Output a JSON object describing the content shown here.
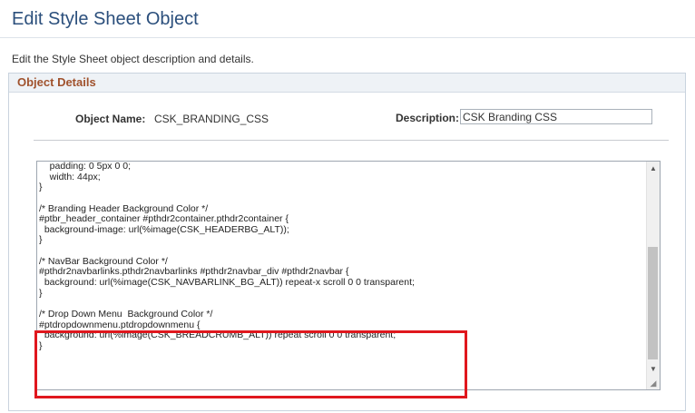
{
  "page": {
    "title": "Edit Style Sheet Object",
    "intro": "Edit the Style Sheet object description and details."
  },
  "group": {
    "header": "Object Details",
    "object_name_label": "Object Name:",
    "object_name_value": "CSK_BRANDING_CSS",
    "description_label": "Description:",
    "description_value": "CSK Branding CSS"
  },
  "editor": {
    "lines": [
      "    padding: 0 5px 0 0;",
      "    width: 44px;",
      "}",
      "",
      "/* Branding Header Background Color */",
      "#ptbr_header_container #pthdr2container.pthdr2container {",
      "  background-image: url(%image(CSK_HEADERBG_ALT));",
      "}",
      "",
      "/* NavBar Background Color */",
      "#pthdr2navbarlinks.pthdr2navbarlinks #pthdr2navbar_div #pthdr2navbar {",
      "  background: url(%image(CSK_NAVBARLINK_BG_ALT)) repeat-x scroll 0 0 transparent;",
      "}",
      "",
      "/* Drop Down Menu  Background Color */",
      "#ptdropdownmenu.ptdropdownmenu {",
      "  background: url(%image(CSK_BREADCRUMB_ALT)) repeat scroll 0 0 transparent;",
      "}"
    ]
  },
  "icons": {
    "scroll_up": "scroll-up-arrow-icon",
    "scroll_down": "scroll-down-arrow-icon",
    "resize": "resize-grip-icon"
  },
  "colors": {
    "title": "#2b4f7c",
    "group_header": "#a0522d",
    "highlight": "#e0171d"
  }
}
